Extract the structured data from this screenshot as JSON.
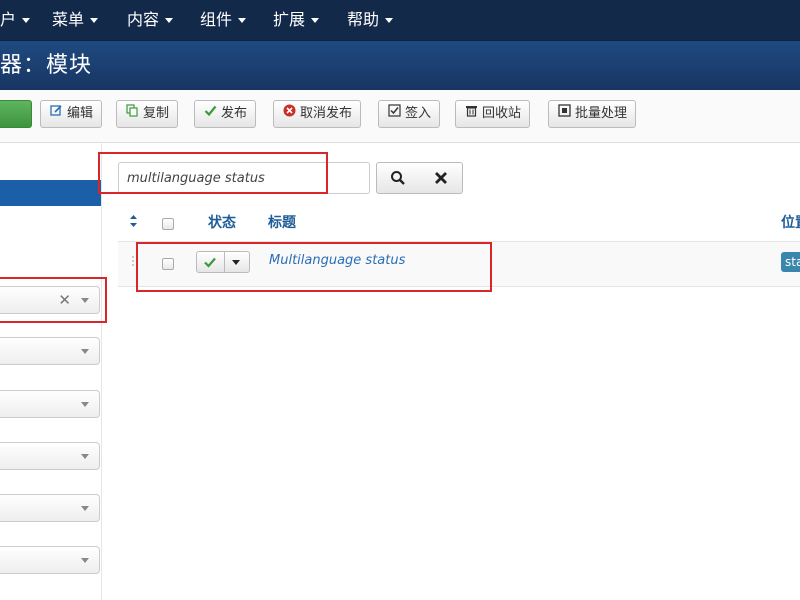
{
  "topnav": {
    "menus": [
      {
        "label": "户"
      },
      {
        "label": "菜单"
      },
      {
        "label": "内容"
      },
      {
        "label": "组件"
      },
      {
        "label": "扩展"
      },
      {
        "label": "帮助"
      }
    ]
  },
  "header": {
    "title": "器：模块"
  },
  "toolbar": {
    "buttons": [
      {
        "label": "编辑",
        "icon": "edit-icon"
      },
      {
        "label": "复制",
        "icon": "copy-icon"
      },
      {
        "label": "发布",
        "icon": "check-icon"
      },
      {
        "label": "取消发布",
        "icon": "cancel-circle-icon"
      },
      {
        "label": "签入",
        "icon": "checkbox-icon"
      },
      {
        "label": "回收站",
        "icon": "trash-icon"
      },
      {
        "label": "批量处理",
        "icon": "batch-icon"
      }
    ]
  },
  "search": {
    "value": "multilanguage status",
    "search_icon": "search-icon",
    "clear_icon": "close-icon"
  },
  "table": {
    "headers": {
      "status": "状态",
      "title": "标题",
      "position": "位置"
    },
    "rows": [
      {
        "title": "Multilanguage status",
        "position_badge": "sta",
        "published": true
      }
    ]
  },
  "colors": {
    "topnav": "#13294a",
    "header": "#1a3867",
    "highlight": "#d9262b",
    "link": "#2a6eb8"
  }
}
